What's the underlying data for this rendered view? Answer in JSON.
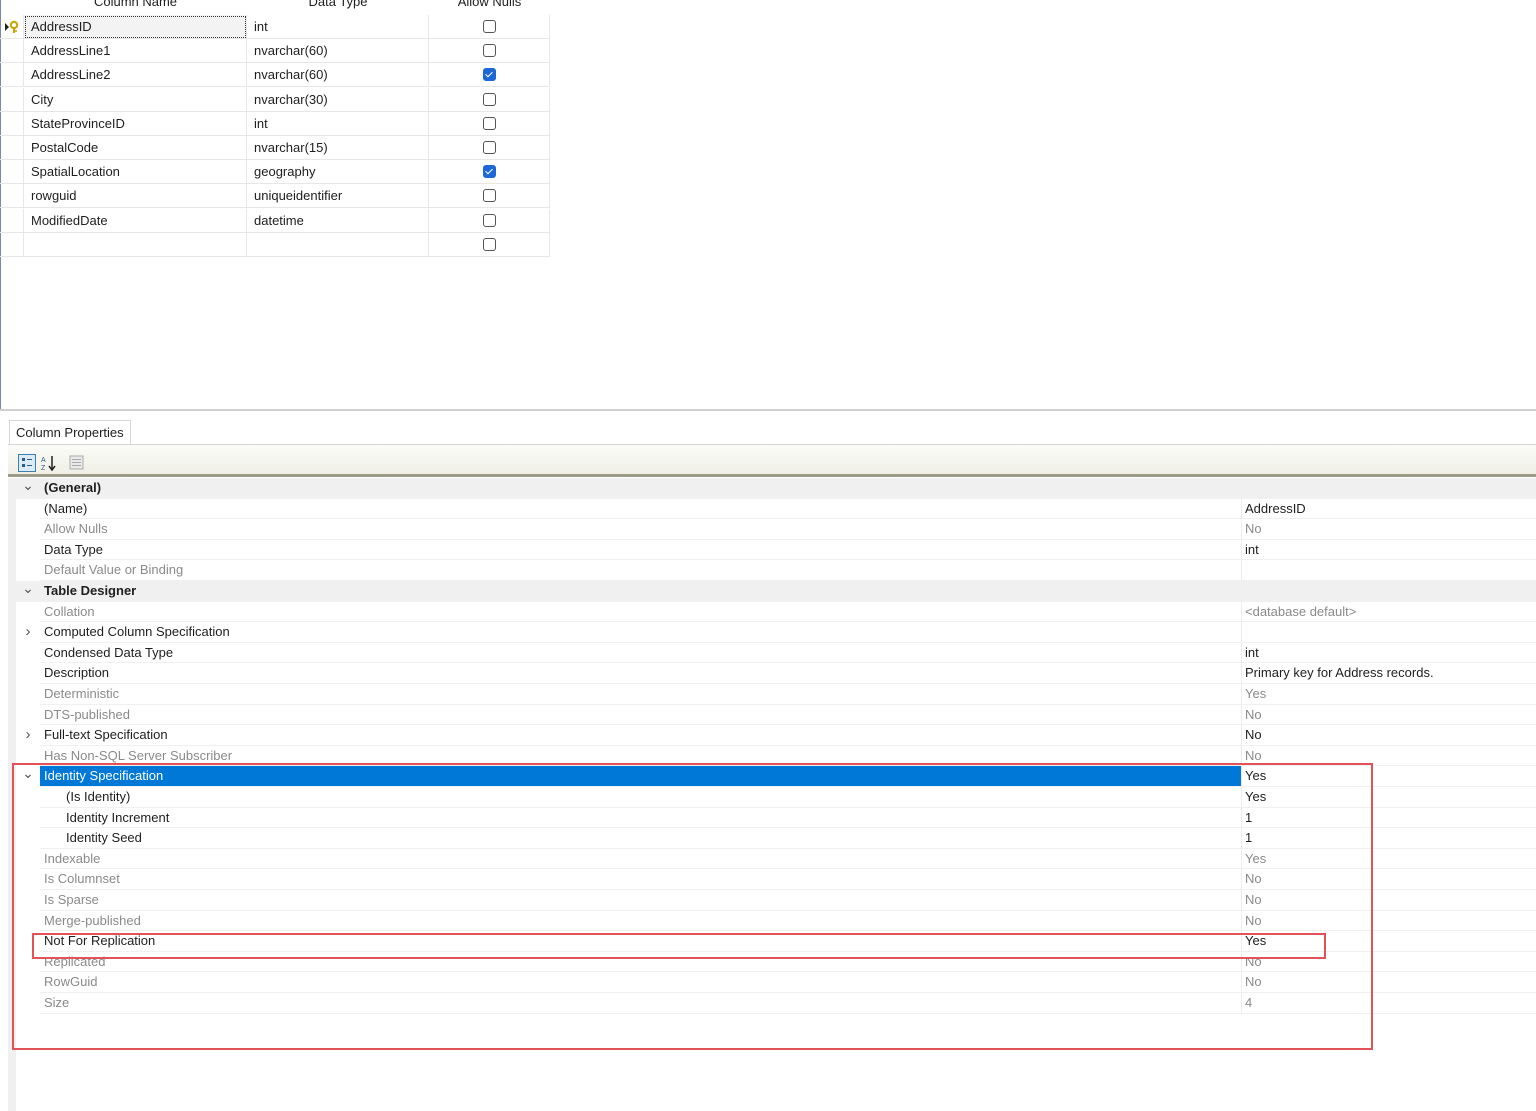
{
  "grid": {
    "headers": {
      "name": "Column Name",
      "type": "Data Type",
      "nulls": "Allow Nulls"
    },
    "rows": [
      {
        "name": "AddressID",
        "type": "int",
        "allow_nulls": false,
        "primary_key": true
      },
      {
        "name": "AddressLine1",
        "type": "nvarchar(60)",
        "allow_nulls": false
      },
      {
        "name": "AddressLine2",
        "type": "nvarchar(60)",
        "allow_nulls": true
      },
      {
        "name": "City",
        "type": "nvarchar(30)",
        "allow_nulls": false
      },
      {
        "name": "StateProvinceID",
        "type": "int",
        "allow_nulls": false
      },
      {
        "name": "PostalCode",
        "type": "nvarchar(15)",
        "allow_nulls": false
      },
      {
        "name": "SpatialLocation",
        "type": "geography",
        "allow_nulls": true
      },
      {
        "name": "rowguid",
        "type": "uniqueidentifier",
        "allow_nulls": false
      },
      {
        "name": "ModifiedDate",
        "type": "datetime",
        "allow_nulls": false
      },
      {
        "name": "",
        "type": "",
        "allow_nulls": false
      }
    ]
  },
  "properties": {
    "tab_label": "Column Properties",
    "toolbar_icons": [
      "categorized-icon",
      "alphabetical-sort-icon",
      "property-pages-icon"
    ],
    "rows": [
      {
        "name": "(General)",
        "value": "",
        "kind": "category",
        "expander": "expanded"
      },
      {
        "name": "(Name)",
        "value": "AddressID",
        "kind": "normal"
      },
      {
        "name": "Allow Nulls",
        "value": "No",
        "kind": "dim"
      },
      {
        "name": "Data Type",
        "value": "int",
        "kind": "normal"
      },
      {
        "name": "Default Value or Binding",
        "value": "",
        "kind": "dim"
      },
      {
        "name": "Table Designer",
        "value": "",
        "kind": "category",
        "expander": "expanded"
      },
      {
        "name": "Collation",
        "value": "<database default>",
        "kind": "dim"
      },
      {
        "name": "Computed Column Specification",
        "value": "",
        "kind": "normal",
        "expander": "collapsed"
      },
      {
        "name": "Condensed Data Type",
        "value": "int",
        "kind": "normal"
      },
      {
        "name": "Description",
        "value": "Primary key for Address records.",
        "kind": "normal"
      },
      {
        "name": "Deterministic",
        "value": "Yes",
        "kind": "dim"
      },
      {
        "name": "DTS-published",
        "value": "No",
        "kind": "dim"
      },
      {
        "name": "Full-text Specification",
        "value": "No",
        "kind": "normal",
        "expander": "collapsed"
      },
      {
        "name": "Has Non-SQL Server Subscriber",
        "value": "No",
        "kind": "dim"
      },
      {
        "name": "Identity Specification",
        "value": "Yes",
        "kind": "selected",
        "expander": "expanded"
      },
      {
        "name": "(Is Identity)",
        "value": "Yes",
        "kind": "sub"
      },
      {
        "name": "Identity Increment",
        "value": "1",
        "kind": "sub"
      },
      {
        "name": "Identity Seed",
        "value": "1",
        "kind": "sub"
      },
      {
        "name": "Indexable",
        "value": "Yes",
        "kind": "dim"
      },
      {
        "name": "Is Columnset",
        "value": "No",
        "kind": "dim"
      },
      {
        "name": "Is Sparse",
        "value": "No",
        "kind": "dim"
      },
      {
        "name": "Merge-published",
        "value": "No",
        "kind": "dim"
      },
      {
        "name": "Not For Replication",
        "value": "Yes",
        "kind": "normal"
      },
      {
        "name": "Replicated",
        "value": "No",
        "kind": "dim"
      },
      {
        "name": "RowGuid",
        "value": "No",
        "kind": "dim"
      },
      {
        "name": "Size",
        "value": "4",
        "kind": "dim"
      }
    ]
  },
  "colors": {
    "selection": "#0078d7",
    "highlight": "#e15259",
    "checkbox": "#1d68d6"
  }
}
